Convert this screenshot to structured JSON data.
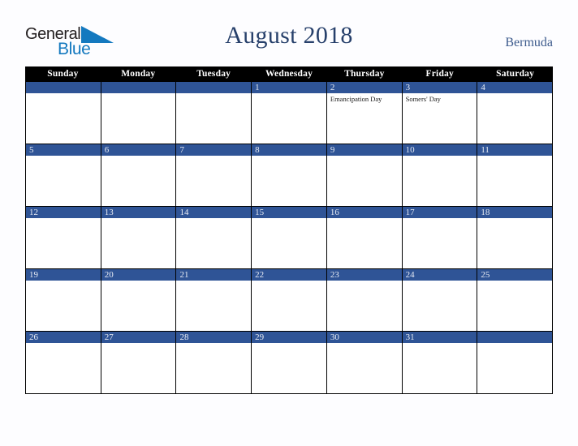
{
  "brand": {
    "name_part1": "General",
    "name_part2": "Blue",
    "triangle_icon": "blue-triangle-icon",
    "colors": {
      "general_text": "#231f20",
      "blue_text": "#1479bf",
      "triangle": "#1479bf"
    }
  },
  "header": {
    "title": "August 2018",
    "country": "Bermuda",
    "title_color": "#27406b",
    "country_color": "#3c5a8c"
  },
  "calendar": {
    "header_bg": "#000000",
    "daynum_bar_bg": "#2f5496",
    "daynum_color": "#e8ecf4",
    "day_names": [
      "Sunday",
      "Monday",
      "Tuesday",
      "Wednesday",
      "Thursday",
      "Friday",
      "Saturday"
    ],
    "weeks": [
      [
        {
          "date": "",
          "holiday": ""
        },
        {
          "date": "",
          "holiday": ""
        },
        {
          "date": "",
          "holiday": ""
        },
        {
          "date": "1",
          "holiday": ""
        },
        {
          "date": "2",
          "holiday": "Emancipation Day"
        },
        {
          "date": "3",
          "holiday": "Somers' Day"
        },
        {
          "date": "4",
          "holiday": ""
        }
      ],
      [
        {
          "date": "5",
          "holiday": ""
        },
        {
          "date": "6",
          "holiday": ""
        },
        {
          "date": "7",
          "holiday": ""
        },
        {
          "date": "8",
          "holiday": ""
        },
        {
          "date": "9",
          "holiday": ""
        },
        {
          "date": "10",
          "holiday": ""
        },
        {
          "date": "11",
          "holiday": ""
        }
      ],
      [
        {
          "date": "12",
          "holiday": ""
        },
        {
          "date": "13",
          "holiday": ""
        },
        {
          "date": "14",
          "holiday": ""
        },
        {
          "date": "15",
          "holiday": ""
        },
        {
          "date": "16",
          "holiday": ""
        },
        {
          "date": "17",
          "holiday": ""
        },
        {
          "date": "18",
          "holiday": ""
        }
      ],
      [
        {
          "date": "19",
          "holiday": ""
        },
        {
          "date": "20",
          "holiday": ""
        },
        {
          "date": "21",
          "holiday": ""
        },
        {
          "date": "22",
          "holiday": ""
        },
        {
          "date": "23",
          "holiday": ""
        },
        {
          "date": "24",
          "holiday": ""
        },
        {
          "date": "25",
          "holiday": ""
        }
      ],
      [
        {
          "date": "26",
          "holiday": ""
        },
        {
          "date": "27",
          "holiday": ""
        },
        {
          "date": "28",
          "holiday": ""
        },
        {
          "date": "29",
          "holiday": ""
        },
        {
          "date": "30",
          "holiday": ""
        },
        {
          "date": "31",
          "holiday": ""
        },
        {
          "date": "",
          "holiday": ""
        }
      ]
    ]
  }
}
